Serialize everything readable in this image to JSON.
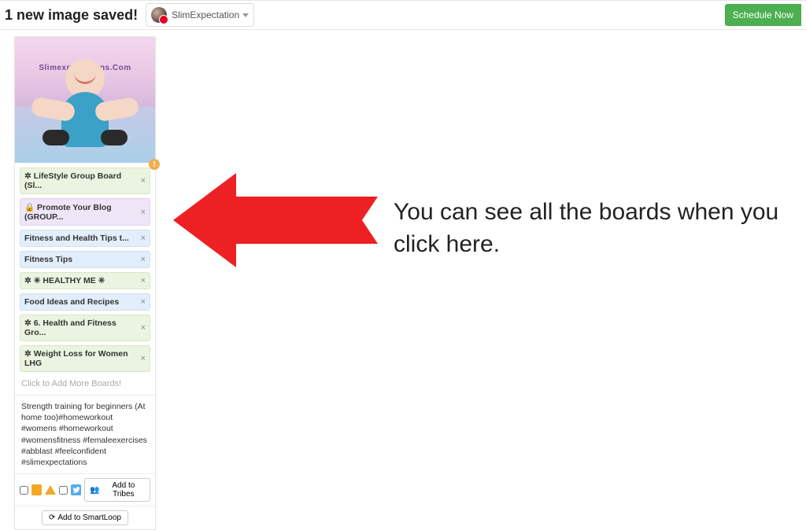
{
  "header": {
    "saved_message": "1 new image saved!",
    "profile_name": "SlimExpectation",
    "schedule_label": "Schedule Now"
  },
  "card": {
    "image_label": "Slimexpectations.Com",
    "warning_badge": "!",
    "boards": [
      {
        "label": "LifeStyle Group Board (Sl...",
        "icon": "dot",
        "color": "green"
      },
      {
        "label": "Promote Your Blog (GROUP...",
        "icon": "lock",
        "color": "purple"
      },
      {
        "label": "Fitness and Health Tips t...",
        "icon": "",
        "color": "blue"
      },
      {
        "label": "Fitness Tips",
        "icon": "",
        "color": "blue"
      },
      {
        "label": "✳ HEALTHY ME ✳",
        "icon": "dot",
        "color": "green"
      },
      {
        "label": "Food Ideas and Recipes",
        "icon": "",
        "color": "blue"
      },
      {
        "label": "6. Health and Fitness Gro...",
        "icon": "dot",
        "color": "green"
      },
      {
        "label": "Weight Loss for Women LHG",
        "icon": "dot",
        "color": "green"
      }
    ],
    "add_boards_placeholder": "Click to Add More Boards!",
    "description": "Strength training for beginners (At home too)#homeworkout #womens #homeworkout #womensfitness #femaleexercises #abblast #feelconfident #slimexpectations",
    "add_tribes_label": "Add to Tribes",
    "add_smartloop_label": "Add to SmartLoop"
  },
  "annotation": {
    "text": "You can see all the boards when you click here."
  },
  "icons": {
    "lock": "🔒",
    "group_dot": "✲",
    "tribes": "👥",
    "loop": "⟳",
    "close": "×"
  }
}
